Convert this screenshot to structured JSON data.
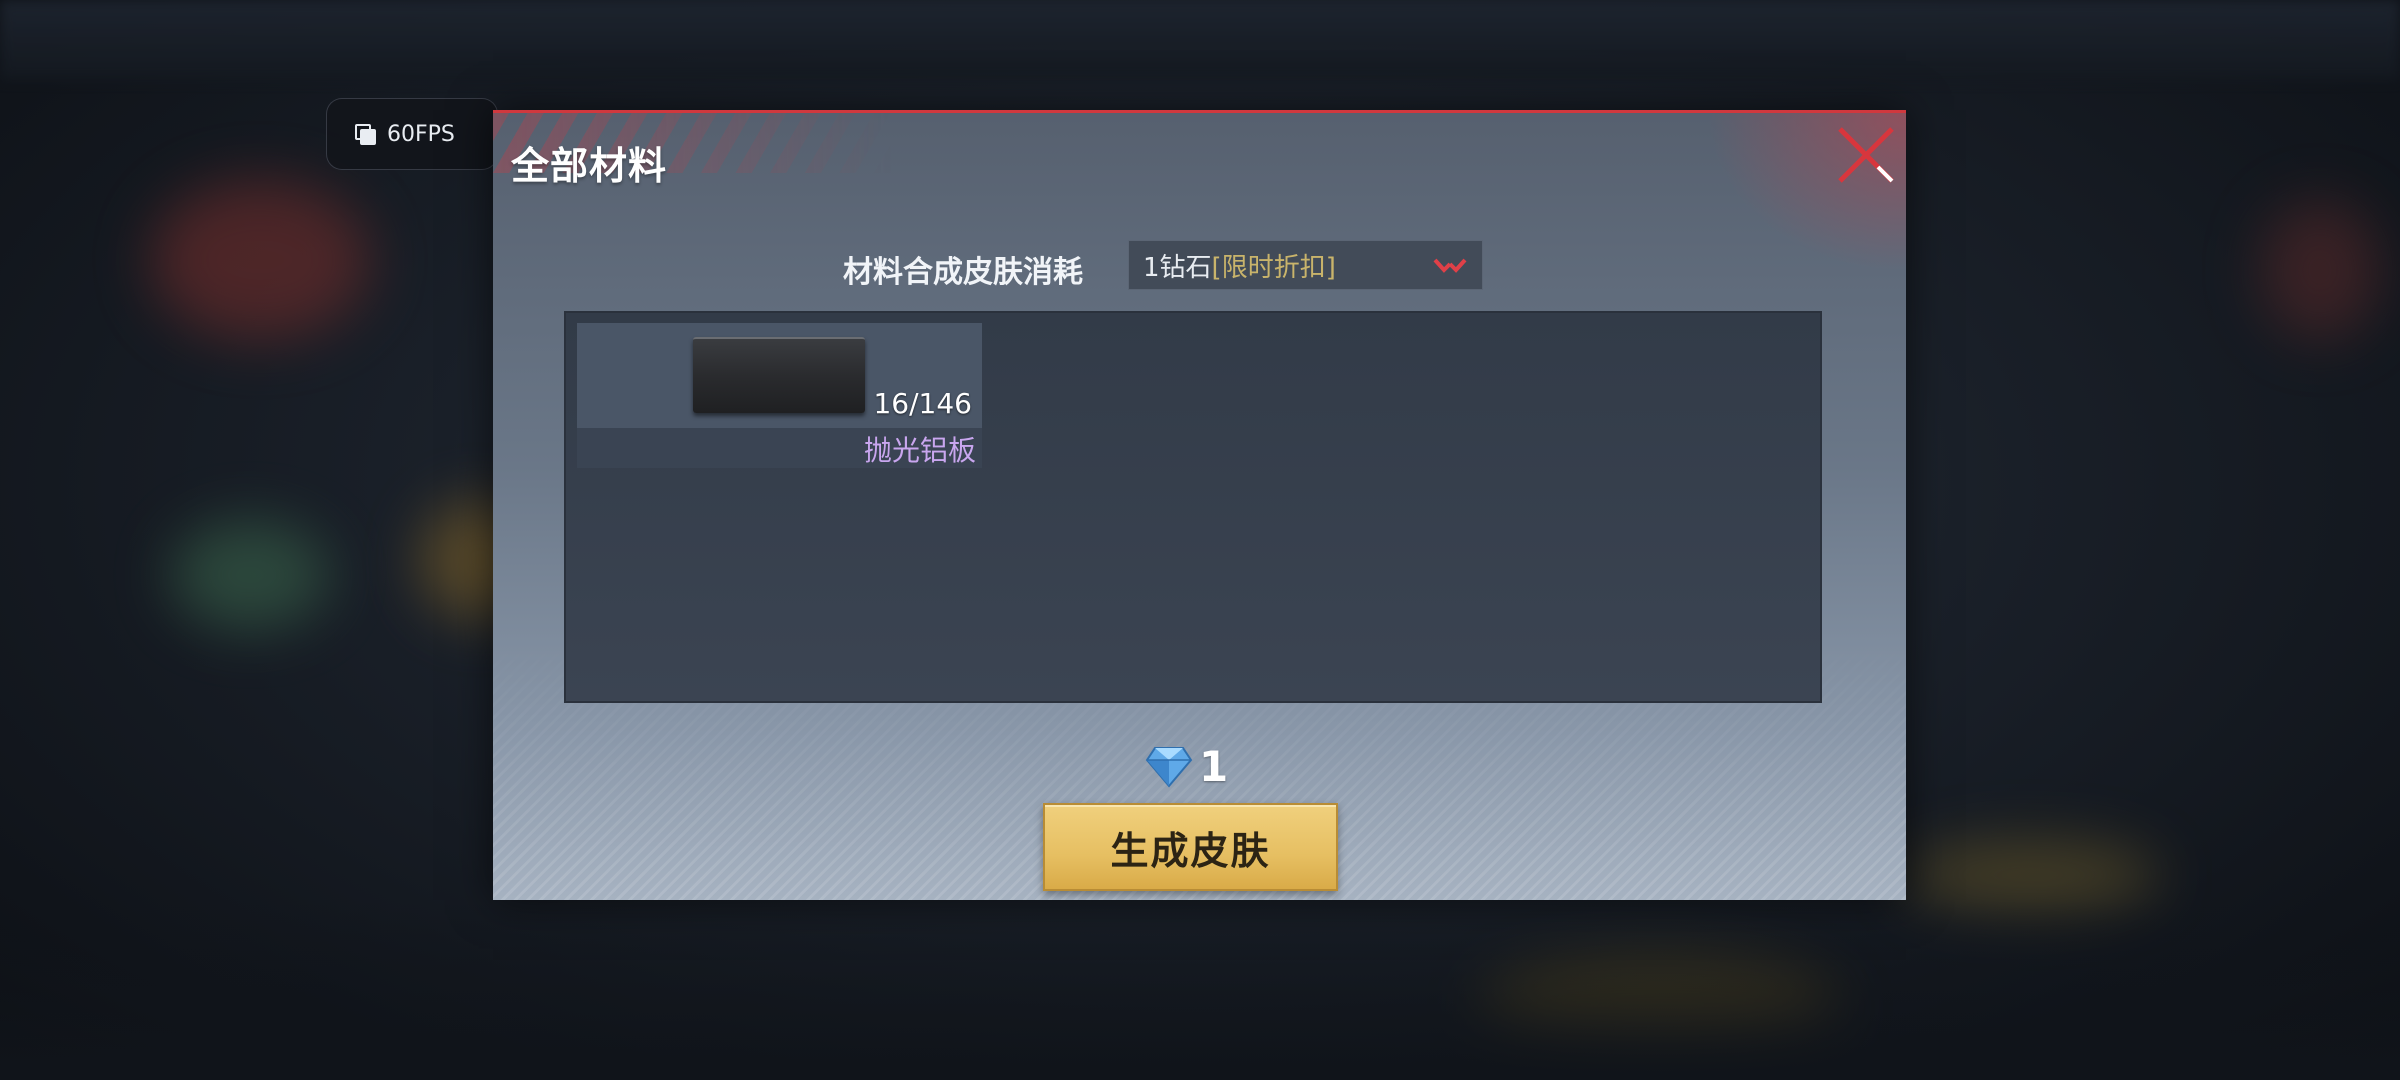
{
  "overlay": {
    "fps_label": "60FPS"
  },
  "dialog": {
    "title": "全部材料",
    "close_icon": "close-x-icon",
    "cost": {
      "label": "材料合成皮肤消耗",
      "selected_amount": "1钻石",
      "selected_tag": "[限时折扣]"
    },
    "materials": [
      {
        "name": "抛光铝板",
        "count": "16/146",
        "icon": "polished-aluminum-plate-image"
      }
    ],
    "price": {
      "icon": "diamond-icon",
      "value": "1"
    },
    "generate_button_label": "生成皮肤"
  },
  "colors": {
    "accent_red": "#d0383e",
    "discount_gold": "#c9b46b",
    "material_name_purple": "#c9a6ef",
    "button_gold": "#e6bf62"
  }
}
